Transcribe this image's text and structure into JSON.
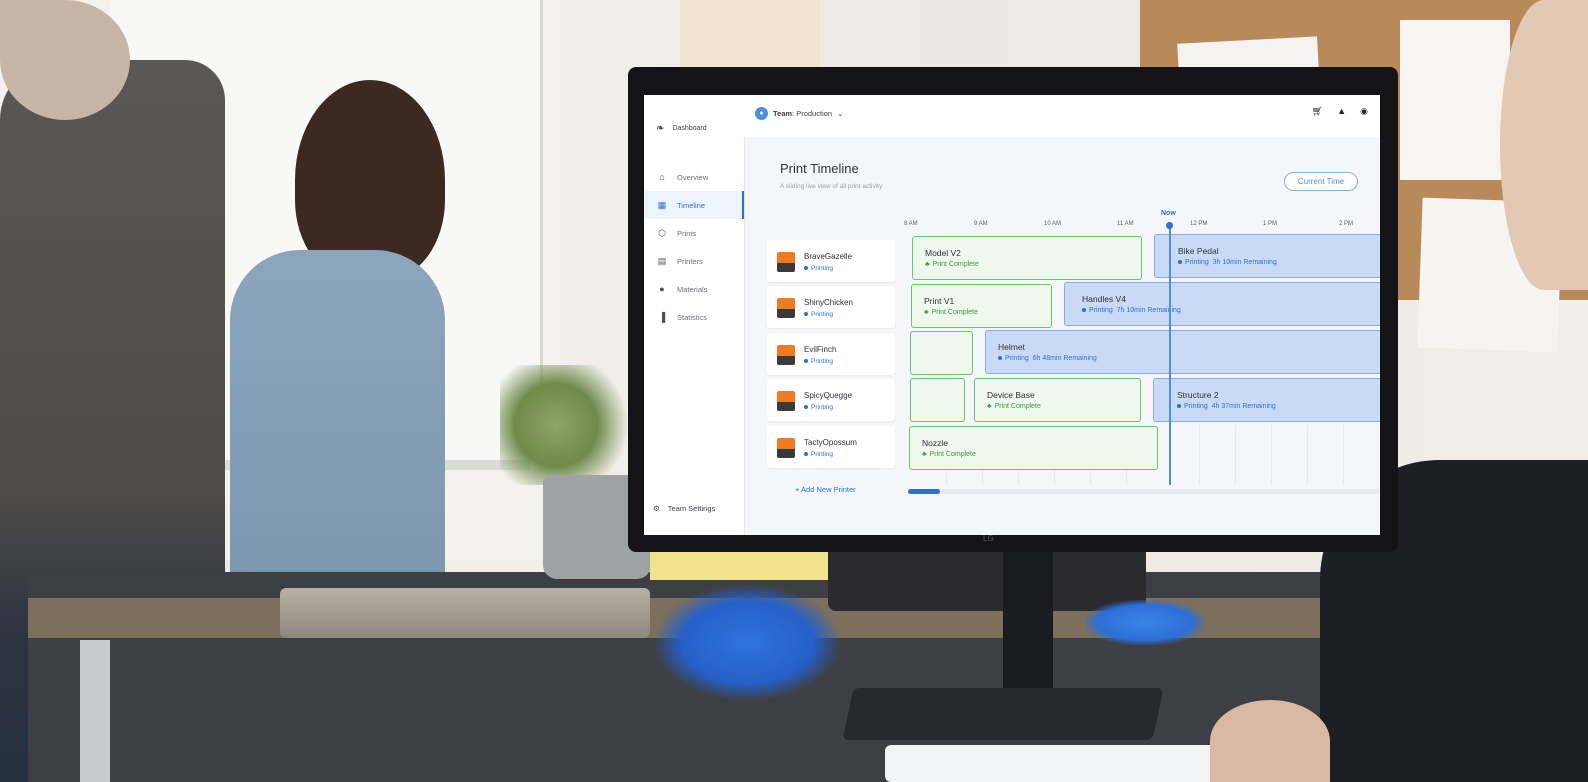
{
  "app": {
    "logo_label": "Dashboard"
  },
  "sidebar": {
    "items": [
      {
        "label": "Overview",
        "icon": "home-icon",
        "active": false
      },
      {
        "label": "Timeline",
        "icon": "calendar-icon",
        "active": true
      },
      {
        "label": "Prints",
        "icon": "cube-icon",
        "active": false
      },
      {
        "label": "Printers",
        "icon": "printer-icon",
        "active": false
      },
      {
        "label": "Materials",
        "icon": "drop-icon",
        "active": false
      },
      {
        "label": "Statistics",
        "icon": "bar-chart-icon",
        "active": false
      }
    ],
    "team_settings": "Team Settings"
  },
  "topbar": {
    "team_prefix": "Team",
    "team_name": "Production",
    "icons": [
      "cart-icon",
      "bell-icon",
      "user-icon"
    ]
  },
  "main": {
    "title": "Print Timeline",
    "subtitle": "A sliding live view of all print activity",
    "current_time_button": "Current Time",
    "now_label": "Now",
    "hours": [
      "8 AM",
      "9 AM",
      "10 AM",
      "11 AM",
      "12 PM",
      "1 PM",
      "2 PM"
    ],
    "printers": [
      {
        "name": "BraveGazelle",
        "status": "Printing"
      },
      {
        "name": "ShinyChicken",
        "status": "Printing"
      },
      {
        "name": "EvilFinch",
        "status": "Printing"
      },
      {
        "name": "SpicyQuegge",
        "status": "Printing"
      },
      {
        "name": "TactyOpossum",
        "status": "Printing"
      }
    ],
    "add_printer": "+ Add New Printer",
    "jobs": [
      {
        "name": "Model V2",
        "status": "Print Complete"
      },
      {
        "name": "Bike Pedal",
        "status": "Printing",
        "remaining": "3h 10min Remaining"
      },
      {
        "name": "Print V1",
        "status": "Print Complete"
      },
      {
        "name": "Handles V4",
        "status": "Printing",
        "remaining": "7h 10min Remaining"
      },
      {
        "name": "Helmet",
        "status": "Printing",
        "remaining": "6h 48min Remaining"
      },
      {
        "name": "Device Base",
        "status": "Print Complete"
      },
      {
        "name": "Structure 2",
        "status": "Printing",
        "remaining": "4h 37min Remaining"
      },
      {
        "name": "Nozzle",
        "status": "Print Complete"
      }
    ]
  },
  "monitor": {
    "brand": "LG"
  },
  "colors": {
    "accent": "#2f6fd0",
    "complete": "#6ec267",
    "printing_fill": "#c9daf6"
  }
}
